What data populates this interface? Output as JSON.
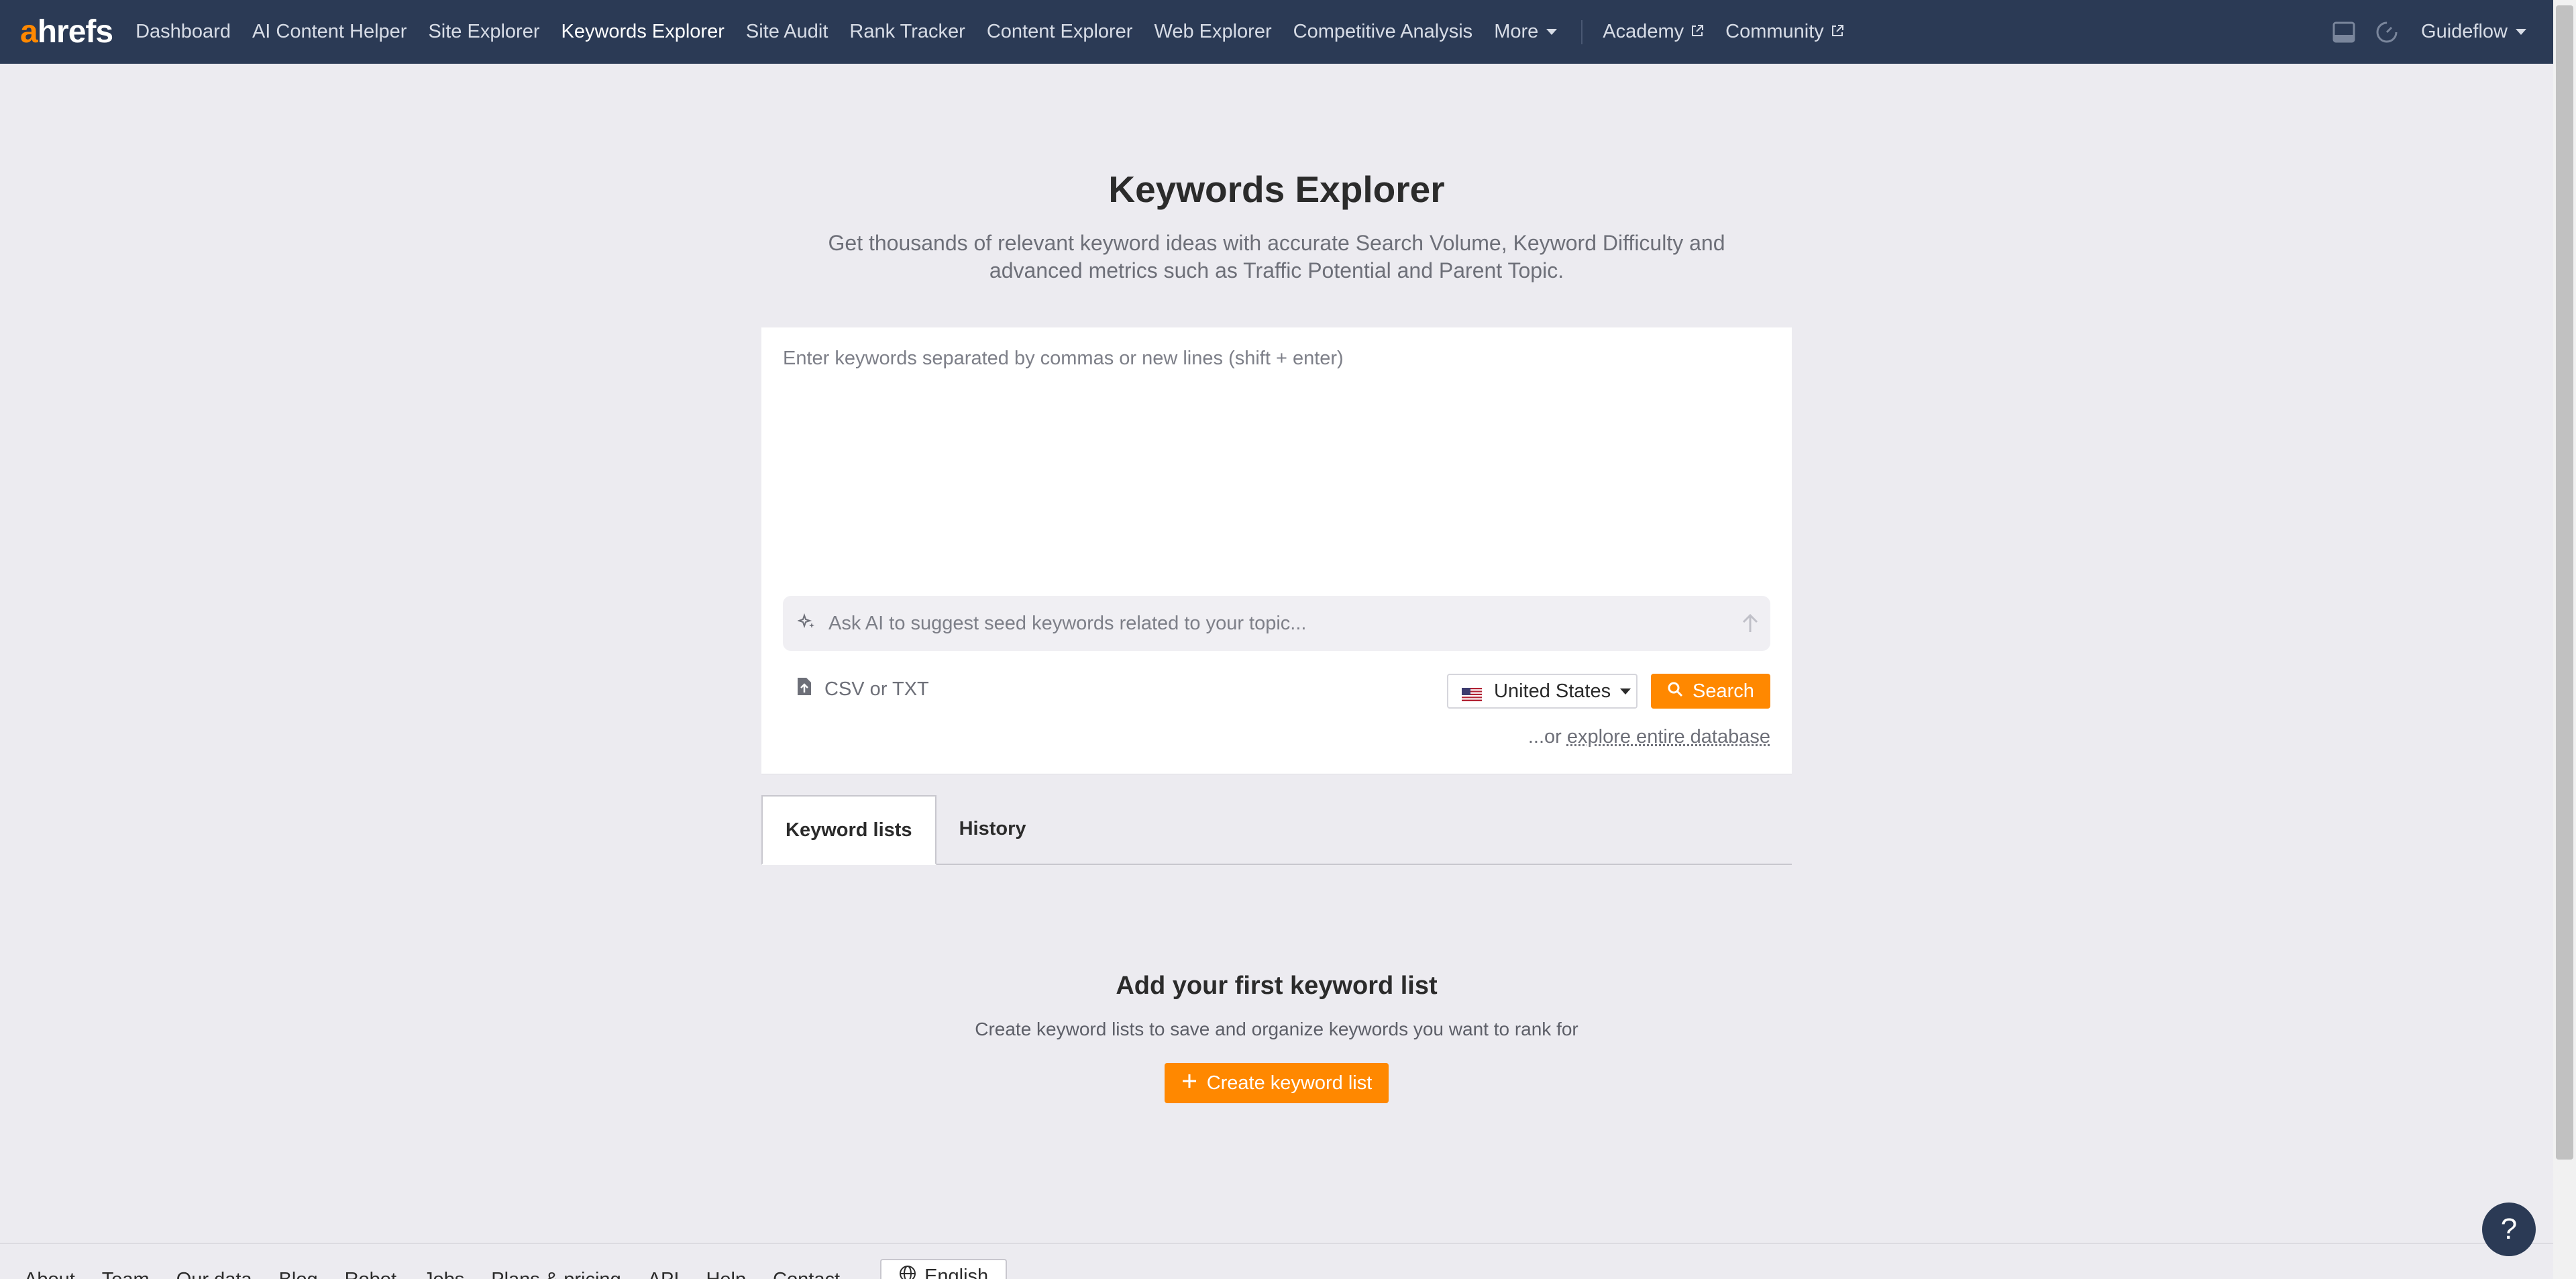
{
  "nav": {
    "logo_a": "a",
    "logo_rest": "hrefs",
    "items": [
      {
        "label": "Dashboard"
      },
      {
        "label": "AI Content Helper"
      },
      {
        "label": "Site Explorer"
      },
      {
        "label": "Keywords Explorer",
        "active": true
      },
      {
        "label": "Site Audit"
      },
      {
        "label": "Rank Tracker"
      },
      {
        "label": "Content Explorer"
      },
      {
        "label": "Web Explorer"
      },
      {
        "label": "Competitive Analysis"
      }
    ],
    "more_label": "More",
    "external": [
      {
        "label": "Academy"
      },
      {
        "label": "Community"
      }
    ],
    "account_label": "Guideflow",
    "icons": [
      "panel-icon",
      "speed-icon"
    ]
  },
  "hero": {
    "title": "Keywords Explorer",
    "subtitle": "Get thousands of relevant keyword ideas with accurate Search Volume, Keyword Difficulty and advanced metrics such as Traffic Potential and Parent Topic."
  },
  "search": {
    "textarea_placeholder": "Enter keywords separated by commas or new lines (shift + enter)",
    "textarea_value": "",
    "ai_placeholder": "Ask AI to suggest seed keywords related to your topic...",
    "ai_value": "",
    "upload_label": "CSV or TXT",
    "country_label": "United States",
    "search_button_label": "Search",
    "explore_prefix": "...or",
    "explore_link": "explore entire database"
  },
  "tabs": [
    {
      "label": "Keyword lists",
      "active": true
    },
    {
      "label": "History",
      "active": false
    }
  ],
  "empty_state": {
    "title": "Add your first keyword list",
    "description": "Create keyword lists to save and organize keywords you want to rank for",
    "button_label": "Create keyword list"
  },
  "footer": {
    "links": [
      "About",
      "Team",
      "Our data",
      "Blog",
      "Robot",
      "Jobs",
      "Plans & pricing",
      "API",
      "Help",
      "Contact"
    ],
    "language_label": "English"
  },
  "help_label": "?",
  "colors": {
    "nav_bg": "#2b3a55",
    "accent": "#ff8800",
    "page_bg": "#ecebf0"
  }
}
